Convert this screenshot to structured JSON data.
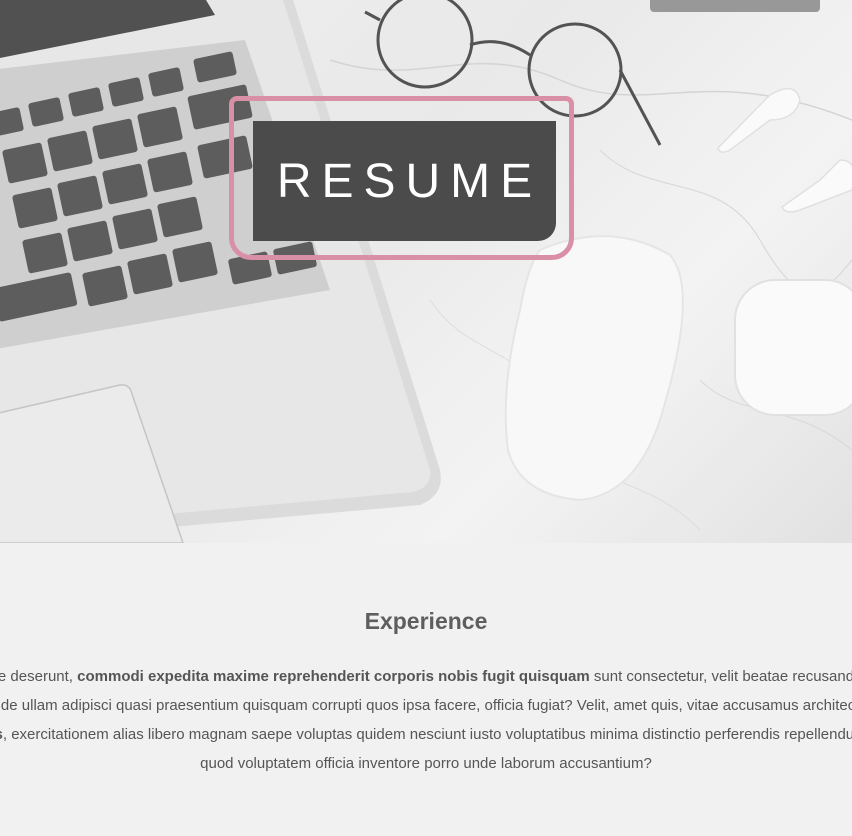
{
  "colors": {
    "badge_fill": "#4b4b4b",
    "badge_frame": "#d98fa6",
    "text": "#555555",
    "heading": "#5e5e5e",
    "background": "#f1f1f1"
  },
  "hero": {
    "badge_label": "RESUME",
    "image_subject": "desk-with-laptop-glasses-mouse-earbuds"
  },
  "experience": {
    "title": "Experience",
    "lines": [
      {
        "pre": "que deserunt, ",
        "bold": "commodi expedita maxime reprehenderit corporis nobis fugit quisquam",
        "post": " sunt consectetur, velit beatae recusandae"
      },
      {
        "pre": "unde ullam adipisci quasi praesentium quisquam corrupti quos ipsa facere, officia fugiat? Velit, amet quis, vitae accusamus architecto",
        "bold": "",
        "post": ""
      },
      {
        "pre": "",
        "bold": "is",
        "post": ", exercitationem alias libero magnam saepe voluptas quidem nesciunt iusto voluptatibus minima distinctio perferendis repellendus"
      },
      {
        "pre": "quod voluptatem officia inventore porro unde laborum accusantium?",
        "bold": "",
        "post": ""
      }
    ]
  }
}
